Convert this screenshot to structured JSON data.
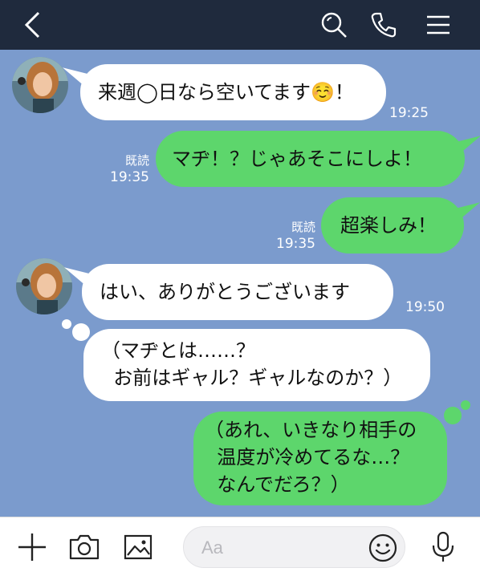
{
  "header": {
    "back_icon": "chevron-left-icon",
    "search_icon": "search-icon",
    "call_icon": "phone-icon",
    "menu_icon": "menu-icon"
  },
  "messages": [
    {
      "side": "in",
      "text": "来週◯日なら空いてます☺️！",
      "time": "19:25"
    },
    {
      "side": "out",
      "text": "マヂ！？じゃあそこにしよ！",
      "read": "既読",
      "time": "19:35"
    },
    {
      "side": "out",
      "text": "超楽しみ！",
      "read": "既読",
      "time": "19:35"
    },
    {
      "side": "in",
      "text": "はい、ありがとうございます",
      "time": "19:50"
    },
    {
      "side": "in-thought",
      "text": "（マヂとは……？\n  お前はギャル？ギャルなのか？）"
    },
    {
      "side": "out-thought",
      "text": "（あれ、いきなり相手の\n  温度が冷めてるな…？\n  なんでだろ？）"
    }
  ],
  "footer": {
    "plus_icon": "plus-icon",
    "camera_icon": "camera-icon",
    "image_icon": "image-icon",
    "input_placeholder": "Aa",
    "emoji_icon": "emoji-icon",
    "mic_icon": "microphone-icon"
  },
  "colors": {
    "header_bg": "#1f2a3d",
    "chat_bg": "#7b9bcd",
    "bubble_out": "#5dd66c",
    "bubble_in": "#ffffff"
  }
}
